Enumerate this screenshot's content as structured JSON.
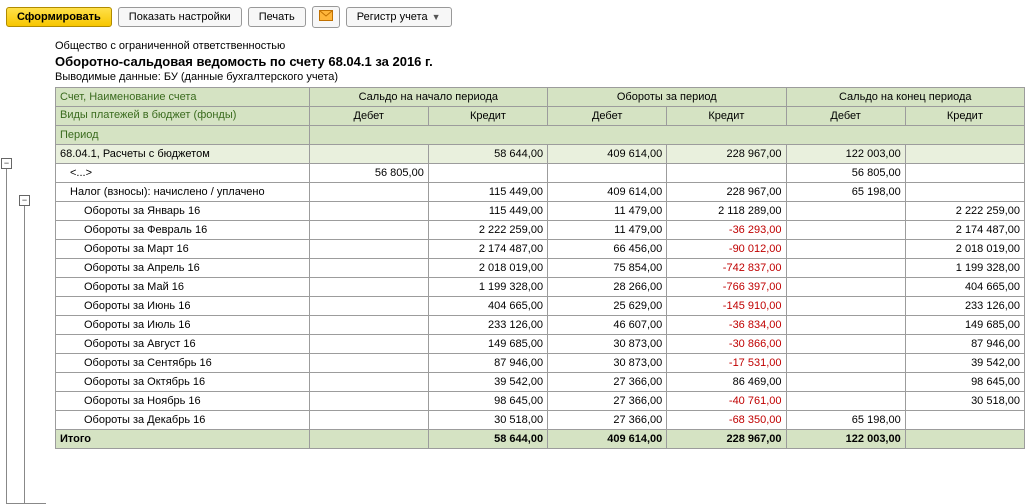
{
  "toolbar": {
    "form": "Сформировать",
    "settings": "Показать настройки",
    "print": "Печать",
    "register": "Регистр учета"
  },
  "org": "Общество с ограниченной ответственностью",
  "title": "Оборотно-сальдовая ведомость по счету 68.04.1 за 2016 г.",
  "sub": "Выводимые данные:  БУ (данные бухгалтерского учета)",
  "hdr_account": "Счет, Наименование счета",
  "hdr_types": "Виды платежей в бюджет (фонды)",
  "hdr_period": "Период",
  "hdr_open": "Сальдо на начало периода",
  "hdr_turn": "Обороты за период",
  "hdr_close": "Сальдо на конец периода",
  "hdr_debit": "Дебет",
  "hdr_credit": "Кредит",
  "rows": [
    {
      "name": "68.04.1, Расчеты с бюджетом",
      "lvl": 0,
      "main": true,
      "c": [
        "",
        "58 644,00",
        "409 614,00",
        "228 967,00",
        "122 003,00",
        ""
      ]
    },
    {
      "name": "<...>",
      "lvl": 1,
      "c": [
        "56 805,00",
        "",
        "",
        "",
        "56 805,00",
        ""
      ]
    },
    {
      "name": "Налог (взносы): начислено / уплачено",
      "lvl": 1,
      "c": [
        "",
        "115 449,00",
        "409 614,00",
        "228 967,00",
        "65 198,00",
        ""
      ]
    },
    {
      "name": "Обороты за Январь 16",
      "lvl": 2,
      "c": [
        "",
        "115 449,00",
        "11 479,00",
        "2 118 289,00",
        "",
        "2 222 259,00"
      ]
    },
    {
      "name": "Обороты за Февраль 16",
      "lvl": 2,
      "c": [
        "",
        "2 222 259,00",
        "11 479,00",
        "-36 293,00",
        "",
        "2 174 487,00"
      ]
    },
    {
      "name": "Обороты за Март 16",
      "lvl": 2,
      "c": [
        "",
        "2 174 487,00",
        "66 456,00",
        "-90 012,00",
        "",
        "2 018 019,00"
      ]
    },
    {
      "name": "Обороты за Апрель 16",
      "lvl": 2,
      "c": [
        "",
        "2 018 019,00",
        "75 854,00",
        "-742 837,00",
        "",
        "1 199 328,00"
      ]
    },
    {
      "name": "Обороты за Май 16",
      "lvl": 2,
      "c": [
        "",
        "1 199 328,00",
        "28 266,00",
        "-766 397,00",
        "",
        "404 665,00"
      ]
    },
    {
      "name": "Обороты за Июнь 16",
      "lvl": 2,
      "c": [
        "",
        "404 665,00",
        "25 629,00",
        "-145 910,00",
        "",
        "233 126,00"
      ]
    },
    {
      "name": "Обороты за Июль 16",
      "lvl": 2,
      "c": [
        "",
        "233 126,00",
        "46 607,00",
        "-36 834,00",
        "",
        "149 685,00"
      ]
    },
    {
      "name": "Обороты за Август 16",
      "lvl": 2,
      "c": [
        "",
        "149 685,00",
        "30 873,00",
        "-30 866,00",
        "",
        "87 946,00"
      ]
    },
    {
      "name": "Обороты за Сентябрь 16",
      "lvl": 2,
      "c": [
        "",
        "87 946,00",
        "30 873,00",
        "-17 531,00",
        "",
        "39 542,00"
      ]
    },
    {
      "name": "Обороты за Октябрь 16",
      "lvl": 2,
      "c": [
        "",
        "39 542,00",
        "27 366,00",
        "86 469,00",
        "",
        "98 645,00"
      ]
    },
    {
      "name": "Обороты за Ноябрь 16",
      "lvl": 2,
      "c": [
        "",
        "98 645,00",
        "27 366,00",
        "-40 761,00",
        "",
        "30 518,00"
      ]
    },
    {
      "name": "Обороты за Декабрь 16",
      "lvl": 2,
      "c": [
        "",
        "30 518,00",
        "27 366,00",
        "-68 350,00",
        "65 198,00",
        ""
      ]
    }
  ],
  "total_label": "Итого",
  "total": [
    "",
    "58 644,00",
    "409 614,00",
    "228 967,00",
    "122 003,00",
    ""
  ],
  "chart_data": {
    "type": "table",
    "title": "Оборотно-сальдовая ведомость по счету 68.04.1 за 2016 г.",
    "columns": [
      "Счет/Период",
      "Сальдо нач. Дебет",
      "Сальдо нач. Кредит",
      "Обороты Дебет",
      "Обороты Кредит",
      "Сальдо кон. Дебет",
      "Сальдо кон. Кредит"
    ],
    "rows": [
      [
        "68.04.1, Расчеты с бюджетом",
        null,
        58644.0,
        409614.0,
        228967.0,
        122003.0,
        null
      ],
      [
        "<...>",
        56805.0,
        null,
        null,
        null,
        56805.0,
        null
      ],
      [
        "Налог (взносы): начислено / уплачено",
        null,
        115449.0,
        409614.0,
        228967.0,
        65198.0,
        null
      ],
      [
        "Обороты за Январь 16",
        null,
        115449.0,
        11479.0,
        2118289.0,
        null,
        2222259.0
      ],
      [
        "Обороты за Февраль 16",
        null,
        2222259.0,
        11479.0,
        -36293.0,
        null,
        2174487.0
      ],
      [
        "Обороты за Март 16",
        null,
        2174487.0,
        66456.0,
        -90012.0,
        null,
        2018019.0
      ],
      [
        "Обороты за Апрель 16",
        null,
        2018019.0,
        75854.0,
        -742837.0,
        null,
        1199328.0
      ],
      [
        "Обороты за Май 16",
        null,
        1199328.0,
        28266.0,
        -766397.0,
        null,
        404665.0
      ],
      [
        "Обороты за Июнь 16",
        null,
        404665.0,
        25629.0,
        -145910.0,
        null,
        233126.0
      ],
      [
        "Обороты за Июль 16",
        null,
        233126.0,
        46607.0,
        -36834.0,
        null,
        149685.0
      ],
      [
        "Обороты за Август 16",
        null,
        149685.0,
        30873.0,
        -30866.0,
        null,
        87946.0
      ],
      [
        "Обороты за Сентябрь 16",
        null,
        87946.0,
        30873.0,
        -17531.0,
        null,
        39542.0
      ],
      [
        "Обороты за Октябрь 16",
        null,
        39542.0,
        27366.0,
        86469.0,
        null,
        98645.0
      ],
      [
        "Обороты за Ноябрь 16",
        null,
        98645.0,
        27366.0,
        -40761.0,
        null,
        30518.0
      ],
      [
        "Обороты за Декабрь 16",
        null,
        30518.0,
        27366.0,
        -68350.0,
        65198.0,
        null
      ],
      [
        "Итого",
        null,
        58644.0,
        409614.0,
        228967.0,
        122003.0,
        null
      ]
    ]
  }
}
